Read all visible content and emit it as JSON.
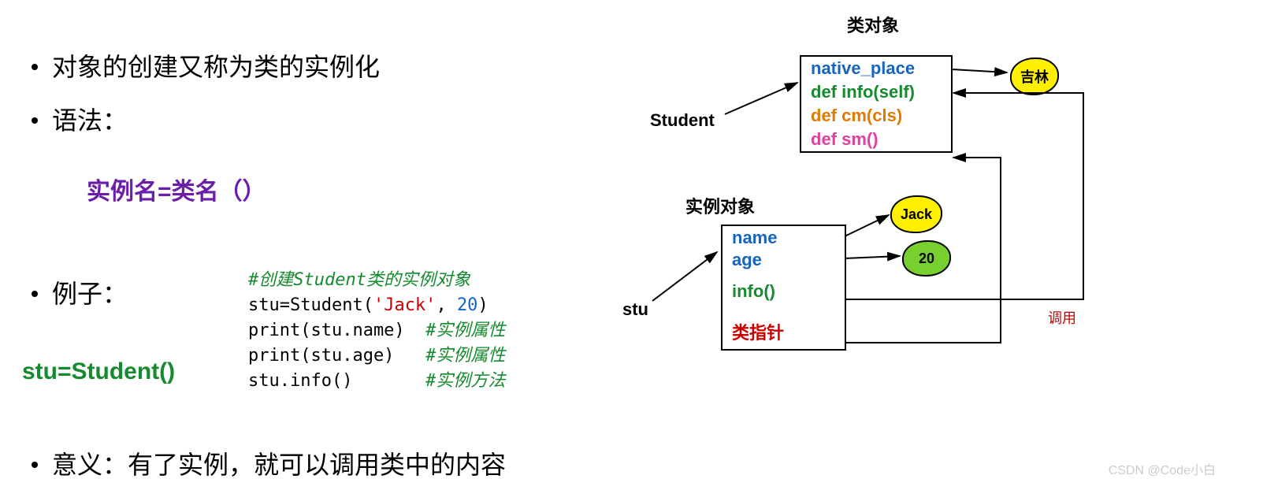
{
  "bullets": {
    "b1": "对象的创建又称为类的实例化",
    "b2": "语法：",
    "b3": "例子：",
    "b4": "意义：有了实例，就可以调用类中的内容"
  },
  "syntax_line": "实例名=类名（）",
  "student_call": "stu=Student()",
  "code": {
    "c1_comment": "#创建Student类的实例对象",
    "c2_pre": "stu=Student(",
    "c2_str": "'Jack'",
    "c2_mid": ", ",
    "c2_num": "20",
    "c2_post": ")",
    "c3_pre": "print(stu.name)",
    "c3_cmt": "#实例属性",
    "c4_pre": "print(stu.age)",
    "c4_cmt": "#实例属性",
    "c5_pre": "stu.info()",
    "c5_cmt": "#实例方法"
  },
  "diagram": {
    "class_title": "类对象",
    "instance_title": "实例对象",
    "class_box": {
      "native_place": "native_place",
      "def_info": "def info(self)",
      "def_cm": "def cm(cls)",
      "def_sm": "def sm()"
    },
    "instance_box": {
      "name": "name",
      "age": "age",
      "info": "info()",
      "class_ptr": "类指针"
    },
    "cloud_jack": "Jack",
    "cloud_20": "20",
    "cloud_jilin": "吉林",
    "label_student": "Student",
    "label_stu": "stu",
    "label_call": "调用"
  },
  "watermark": "CSDN @Code小白"
}
